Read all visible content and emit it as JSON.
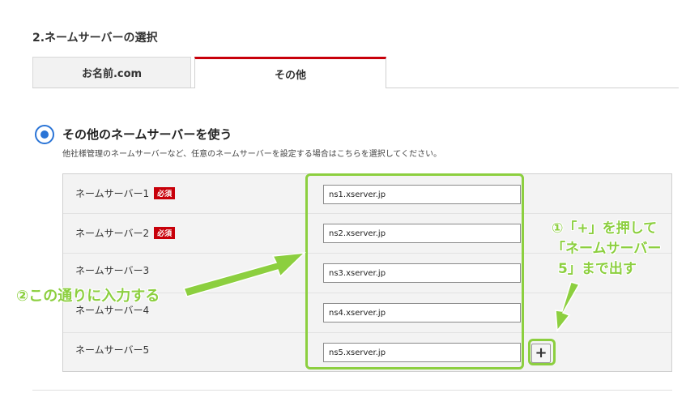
{
  "section": {
    "title": "2.ネームサーバーの選択"
  },
  "tabs": [
    {
      "label": "お名前.com"
    },
    {
      "label": "その他"
    }
  ],
  "option": {
    "label": "その他のネームサーバーを使う",
    "description": "他社様管理のネームサーバーなど、任意のネームサーバーを設定する場合はこちらを選択してください。"
  },
  "nameservers": [
    {
      "label": "ネームサーバー1",
      "badge": "必須",
      "value": "ns1.xserver.jp"
    },
    {
      "label": "ネームサーバー2",
      "badge": "必須",
      "value": "ns2.xserver.jp"
    },
    {
      "label": "ネームサーバー3",
      "value": "ns3.xserver.jp"
    },
    {
      "label": "ネームサーバー4",
      "value": "ns4.xserver.jp"
    },
    {
      "label": "ネームサーバー5",
      "value": "ns5.xserver.jp"
    }
  ],
  "add_button": {
    "label": "+",
    "icon": "plus-icon"
  },
  "annotations": {
    "step1_lines": [
      "①「+」を押して",
      "「ネームサーバー",
      "5」まで出す"
    ],
    "step2": "②この通りに入力する"
  },
  "colors": {
    "accent_red": "#c8000a",
    "radio_blue": "#2a74d6",
    "annotation_green": "#8ccf3f"
  }
}
